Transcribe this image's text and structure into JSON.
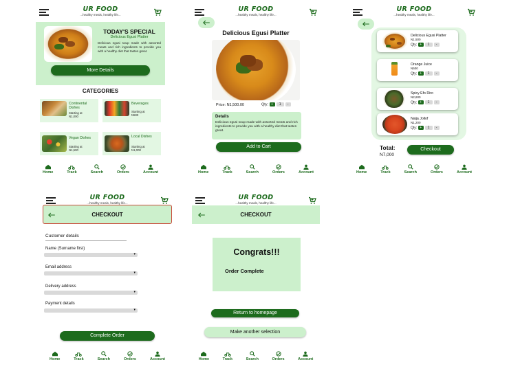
{
  "brand": {
    "name": "UR FOOD",
    "tagline": "...healthy meals, healthy life..."
  },
  "nav": [
    "Home",
    "Track",
    "Search",
    "Orders",
    "Account"
  ],
  "home": {
    "special_title": "TODAY'S SPECIAL",
    "special_name": "Delicious Egusi Platter",
    "special_desc": "Delicious egusi soup made with assorted meats and rich ingredients to provide you with a healthy diet that tastes great.",
    "more_details": "More Details",
    "categories_title": "CATEGORIES",
    "categories": [
      {
        "name": "Continental Dishes",
        "price_label": "Starting at",
        "price": "N1,000"
      },
      {
        "name": "Beverages",
        "price_label": "Starting at",
        "price": "N500"
      },
      {
        "name": "Vegan Dishes",
        "price_label": "Starting at",
        "price": "N1,500"
      },
      {
        "name": "Local Dishes",
        "price_label": "Starting at",
        "price": "N1,000"
      }
    ]
  },
  "detail": {
    "title": "Delicious Egusi Platter",
    "price_label": "Price:",
    "price": "N1,500.00",
    "qty_label": "Qty:",
    "qty": "1",
    "details_title": "Details",
    "details_text": "Delicious egusi soup made with assorted meats and rich ingredients to provide you with a healthy diet that tastes great.",
    "add_to_cart": "Add to Cart"
  },
  "cart": {
    "items": [
      {
        "name": "Delicious Egusi Platter",
        "price": "N1,500",
        "qty": "1"
      },
      {
        "name": "Orange Juice",
        "price": "N500",
        "qty": "1"
      },
      {
        "name": "Spicy Efo Riro",
        "price": "N2,600",
        "qty": "1"
      },
      {
        "name": "Naija Jollof",
        "price": "N1,200",
        "qty": "1"
      }
    ],
    "qty_label": "Qty:",
    "total_label": "Total:",
    "total": "N7,000",
    "checkout": "Checkout"
  },
  "checkout": {
    "title": "CHECKOUT",
    "section": "Customer details",
    "fields": [
      "Name (Surname first)",
      "Email address",
      "Delivery address",
      "Payment details"
    ],
    "complete": "Complete Order"
  },
  "congrats": {
    "title": "CHECKOUT",
    "heading": "Congrats!!!",
    "message": "Order Complete",
    "return_home": "Return to homepage",
    "another": "Make another selection"
  },
  "colors": {
    "primary": "#1d6b1d",
    "light_green": "#ccf0cc",
    "card_green": "#e3f7e3"
  }
}
